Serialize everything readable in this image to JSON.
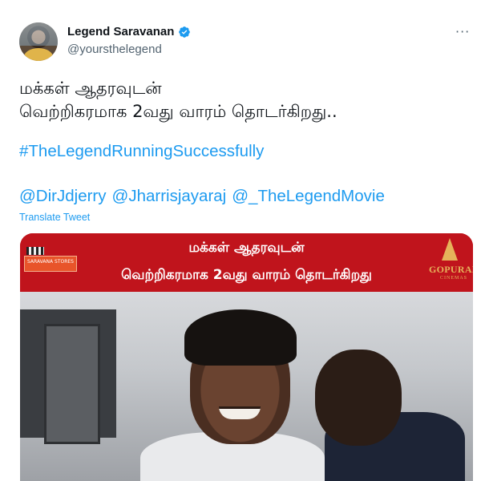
{
  "tweet": {
    "author": {
      "display_name": "Legend Saravanan",
      "handle": "@yoursthelegend",
      "verified": true
    },
    "more_icon": "···",
    "text_lines": [
      "மக்கள் ஆதரவுடன்",
      "வெற்றிகரமாக 2வது வாரம் தொடர்கிறது.."
    ],
    "hashtag": "#TheLegendRunningSuccessfully",
    "mentions": [
      "@DirJdjerry",
      "@Jharrisjayaraj",
      "@_TheLegendMovie"
    ],
    "translate_label": "Translate Tweet",
    "media": {
      "banner_line1": "மக்கள் ஆதரவுடன்",
      "banner_line2": "வெற்றிகரமாக 2வது வாரம் தொடர்கிறது",
      "studio_logo_text": "SARAVANA STORES",
      "cinema_logo_text": "GOPURAM",
      "cinema_logo_sub": "CINEMAS"
    }
  },
  "colors": {
    "accent": "#1d9bf0",
    "banner_red": "#c0141c",
    "text": "#0f1419",
    "secondary": "#536471"
  }
}
